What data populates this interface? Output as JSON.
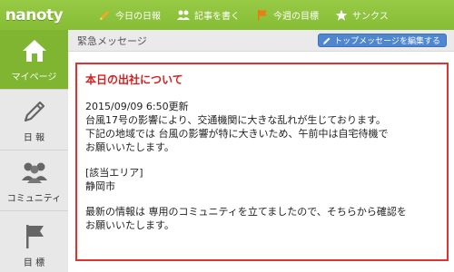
{
  "brand": {
    "logo_text": "nanoty"
  },
  "topnav": {
    "items": [
      {
        "label": "今日の日報",
        "icon": "pencil-icon"
      },
      {
        "label": "記事を書く",
        "icon": "people-icon"
      },
      {
        "label": "今週の目標",
        "icon": "flag-icon"
      },
      {
        "label": "サンクス",
        "icon": "star-icon"
      }
    ]
  },
  "sidebar": {
    "items": [
      {
        "label": "マイページ",
        "icon": "home-icon",
        "active": true
      },
      {
        "label": "日 報",
        "icon": "pencil-icon"
      },
      {
        "label": "コミュニティ",
        "icon": "people-icon"
      },
      {
        "label": "目 標",
        "icon": "flag-icon"
      }
    ]
  },
  "header": {
    "title": "緊急メッセージ",
    "edit_button_label": "トップメッセージを編集する"
  },
  "message": {
    "title": "本日の出社について",
    "lines": [
      "2015/09/09 6:50更新",
      "台風17号の影響により、交通機関に大きな乱れが生じております。",
      "下記の地域では 台風の影響が特に大きいため、午前中は自宅待機で",
      "お願いいたします。",
      "",
      "[該当エリア]",
      "静岡市",
      "",
      "最新の情報は 専用のコミュニティを立てましたので、そちらから確認を",
      "お願いいたします。"
    ]
  },
  "colors": {
    "brand_green": "#86bd35",
    "sidebar_active": "#7fb531",
    "alert_red": "#e1322f",
    "button_blue": "#4f86d0",
    "flag_orange": "#f07a12"
  }
}
